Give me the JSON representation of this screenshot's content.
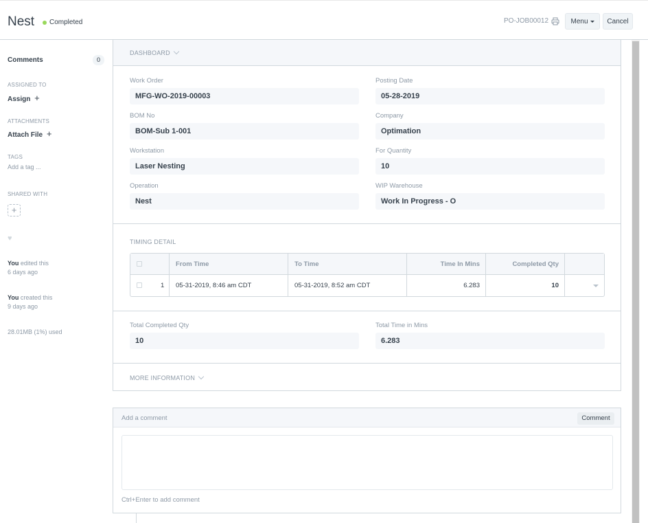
{
  "header": {
    "title": "Nest",
    "status": "Completed",
    "doc_name": "PO-JOB00012",
    "menu_label": "Menu",
    "cancel_label": "Cancel",
    "status_color": "#98d85b"
  },
  "sidebar": {
    "comments_label": "Comments",
    "comments_count": "0",
    "assigned_to_label": "ASSIGNED TO",
    "assign_label": "Assign",
    "attachments_label": "ATTACHMENTS",
    "attach_label": "Attach File",
    "tags_label": "TAGS",
    "add_tag_label": "Add a tag ...",
    "shared_with_label": "SHARED WITH",
    "activity": [
      {
        "who": "You",
        "what": " edited this",
        "when": "6 days ago"
      },
      {
        "who": "You",
        "what": " created this",
        "when": "9 days ago"
      }
    ],
    "storage": "28.01MB (1%) used"
  },
  "form": {
    "dashboard_label": "DASHBOARD",
    "fields": {
      "work_order": {
        "label": "Work Order",
        "value": "MFG-WO-2019-00003"
      },
      "posting_date": {
        "label": "Posting Date",
        "value": "05-28-2019"
      },
      "bom_no": {
        "label": "BOM No",
        "value": "BOM-Sub 1-001"
      },
      "company": {
        "label": "Company",
        "value": "Optimation"
      },
      "workstation": {
        "label": "Workstation",
        "value": "Laser Nesting"
      },
      "for_quantity": {
        "label": "For Quantity",
        "value": "10"
      },
      "operation": {
        "label": "Operation",
        "value": "Nest"
      },
      "wip_warehouse": {
        "label": "WIP Warehouse",
        "value": "Work In Progress - O"
      },
      "total_completed_qty": {
        "label": "Total Completed Qty",
        "value": "10"
      },
      "total_time_in_mins": {
        "label": "Total Time in Mins",
        "value": "6.283"
      }
    },
    "timing_detail_label": "TIMING DETAIL",
    "timing_table": {
      "columns": [
        "From Time",
        "To Time",
        "Time In Mins",
        "Completed Qty"
      ],
      "rows": [
        {
          "idx": "1",
          "from_time": "05-31-2019, 8:46 am CDT",
          "to_time": "05-31-2019, 8:52 am CDT",
          "time_in_mins": "6.283",
          "completed_qty": "10"
        }
      ]
    },
    "more_information_label": "MORE INFORMATION"
  },
  "comment_box": {
    "placeholder_label": "Add a comment",
    "button_label": "Comment",
    "hint": "Ctrl+Enter to add comment"
  }
}
